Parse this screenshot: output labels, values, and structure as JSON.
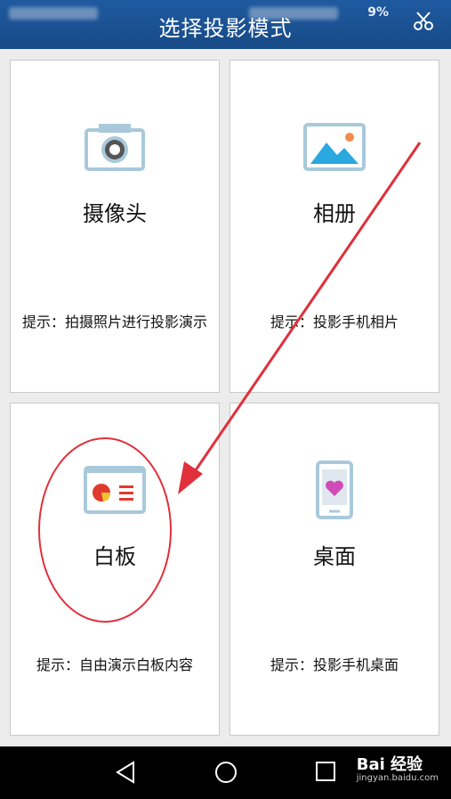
{
  "status_bar": {
    "battery_text": "9%"
  },
  "header": {
    "title": "选择投影模式"
  },
  "modes": [
    {
      "label": "摄像头",
      "hint": "提示：拍摄照片进行投影演示",
      "icon": "camera-icon"
    },
    {
      "label": "相册",
      "hint": "提示：投影手机相片",
      "icon": "photo-album-icon"
    },
    {
      "label": "白板",
      "hint": "提示：自由演示白板内容",
      "icon": "whiteboard-icon"
    },
    {
      "label": "桌面",
      "hint": "提示：投影手机桌面",
      "icon": "phone-desktop-icon"
    }
  ],
  "nav": {
    "back": "back-icon",
    "home": "home-icon",
    "recents": "recents-icon"
  },
  "watermark": {
    "brand": "Bai 经验",
    "url": "jingyan.baidu.com"
  },
  "colors": {
    "header": "#1f5aa0",
    "icon_frame": "#a9c9db",
    "annotation": "#e0303a"
  }
}
